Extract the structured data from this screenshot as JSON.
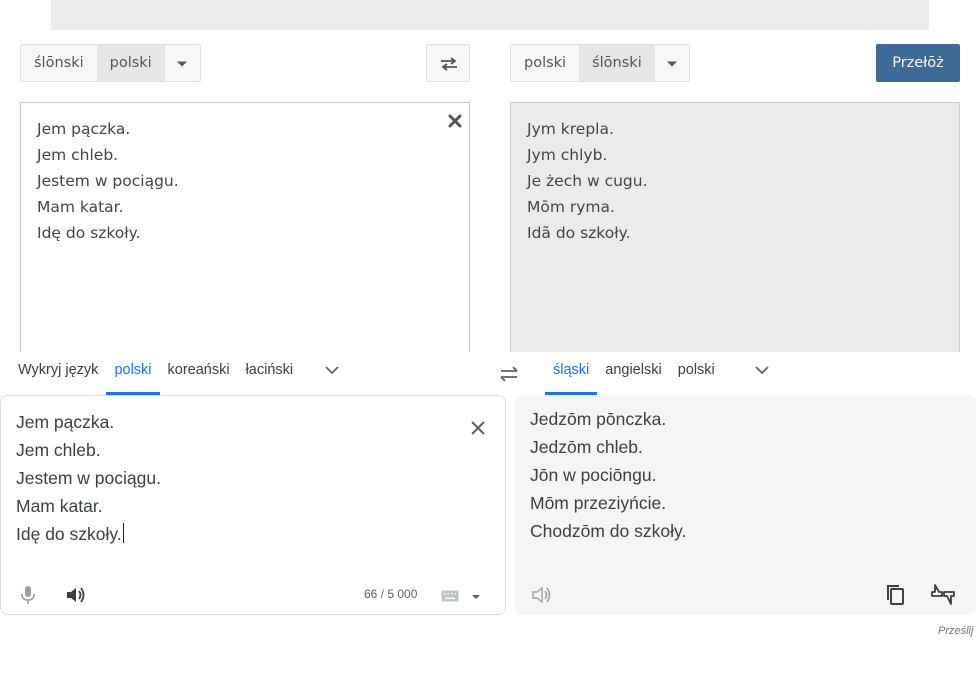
{
  "top_translator": {
    "source_langs": [
      "ślōnski",
      "polski"
    ],
    "source_active_index": 1,
    "target_langs": [
      "polski",
      "ślōnski"
    ],
    "target_active_index": 1,
    "translate_label": "Przełōż",
    "source_lines": [
      "Jem pączka.",
      "Jem chleb.",
      "Jestem w pociągu.",
      "Mam katar.",
      "Idę do szkoły."
    ],
    "target_lines": [
      "Jym krepla.",
      "Jym chlyb.",
      "Je żech w cugu.",
      "Mōm ryma.",
      "Idã do szkoły."
    ]
  },
  "bottom_translator": {
    "source_tabs": [
      "Wykryj język",
      "polski",
      "koreański",
      "łaciński"
    ],
    "source_active_index": 1,
    "target_tabs": [
      "śląski",
      "angielski",
      "polski"
    ],
    "target_active_index": 0,
    "source_lines": [
      "Jem pączka.",
      "Jem chleb.",
      "Jestem w pociągu.",
      "Mam katar.",
      "Idę do szkoły."
    ],
    "target_lines": [
      "Jedzōm pōnczka.",
      "Jedzōm chleb.",
      "Jōn w pociōngu.",
      "Mōm przeziyńcie.",
      "Chodzōm do szkoły."
    ],
    "char_counter": "66 / 5 000",
    "feedback_label": "Prześlij"
  },
  "icons": [
    "swap-icon",
    "clear-icon",
    "close-icon",
    "chevron-down-icon",
    "microphone-icon",
    "speaker-icon",
    "keyboard-icon",
    "copy-icon",
    "rate-icon"
  ],
  "colors": {
    "accent": "#1a73e8",
    "translate_button": "#3e6a97"
  }
}
